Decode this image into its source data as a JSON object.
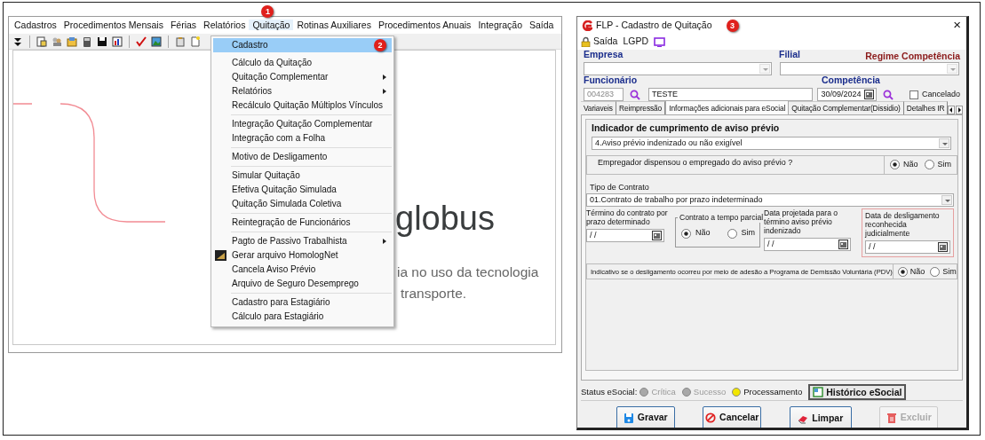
{
  "main_window": {
    "menu": [
      {
        "label": "Cadastros",
        "selected": false
      },
      {
        "label": "Procedimentos Mensais",
        "selected": false
      },
      {
        "label": "Férias",
        "selected": false
      },
      {
        "label": "Relatórios",
        "selected": false
      },
      {
        "label": "Quitação",
        "selected": true,
        "badge": "1"
      },
      {
        "label": "Rotinas Auxiliares",
        "selected": false
      },
      {
        "label": "Procedimentos Anuais",
        "selected": false
      },
      {
        "label": "Integração",
        "selected": false
      },
      {
        "label": "Saída",
        "selected": false
      }
    ],
    "background": {
      "brand": "globus",
      "tagline": [
        "ia no uso da tecnologia",
        "transporte."
      ]
    },
    "dropdown": [
      {
        "kind": "item",
        "label": "Cadastro",
        "selected": true,
        "badge": "2"
      },
      {
        "kind": "item",
        "label": "Cálculo da Quitação",
        "selected": false
      },
      {
        "kind": "submenu",
        "label": "Quitação Complementar",
        "selected": false
      },
      {
        "kind": "submenu",
        "label": "Relatórios",
        "selected": false
      },
      {
        "kind": "item",
        "label": "Recálculo Quitação Múltiplos Vínculos",
        "selected": false
      },
      {
        "kind": "separator"
      },
      {
        "kind": "item",
        "label": "Integração Quitação Complementar",
        "selected": false
      },
      {
        "kind": "item",
        "label": "Integração com a Folha",
        "selected": false
      },
      {
        "kind": "separator"
      },
      {
        "kind": "item",
        "label": "Motivo de Desligamento",
        "selected": false
      },
      {
        "kind": "separator"
      },
      {
        "kind": "item",
        "label": "Simular Quitação",
        "selected": false
      },
      {
        "kind": "item",
        "label": "Efetiva Quitação Simulada",
        "selected": false
      },
      {
        "kind": "item",
        "label": "Quitação Simulada Coletiva",
        "selected": false
      },
      {
        "kind": "separator"
      },
      {
        "kind": "item",
        "label": "Reintegração de Funcionários",
        "selected": false
      },
      {
        "kind": "separator"
      },
      {
        "kind": "submenu",
        "label": "Pagto de Passivo Trabalhista",
        "selected": false
      },
      {
        "kind": "icon_item",
        "label": "Gerar arquivo HomologNet",
        "selected": false
      },
      {
        "kind": "item",
        "label": "Cancela Aviso Prévio",
        "selected": false
      },
      {
        "kind": "item",
        "label": "Arquivo de Seguro Desemprego",
        "selected": false
      },
      {
        "kind": "separator"
      },
      {
        "kind": "item",
        "label": "Cadastro para Estagiário",
        "selected": false
      },
      {
        "kind": "item",
        "label": "Cálculo para Estagiário",
        "selected": false
      }
    ]
  },
  "form_window": {
    "title": "FLP - Cadastro de Quitação",
    "badge": "3",
    "close": "×",
    "toolbar": [
      "Saída",
      "LGPD"
    ],
    "empresa": {
      "label": "Empresa"
    },
    "filial": {
      "label": "Filial"
    },
    "regime": "Regime Competência",
    "funcionario": {
      "label": "Funcionário",
      "code": "004283",
      "name": "TESTE"
    },
    "competencia": {
      "label": "Competência",
      "value": "30/09/2024"
    },
    "cancelado": {
      "label": "Cancelado",
      "checked": false
    },
    "tabs": [
      {
        "label": "Variaveis",
        "selected": false
      },
      {
        "label": "Reimpressão",
        "selected": false
      },
      {
        "label": "Informações adicionais para eSocial",
        "selected": true
      },
      {
        "label": "Quitação Complementar(Dissidio)",
        "selected": false
      },
      {
        "label": "Detalhes IR",
        "selected": false
      }
    ],
    "aviso": {
      "title": "Indicador de cumprimento de aviso prévio",
      "value": "4.Aviso prévio indenizado ou não exigível"
    },
    "dispensou": {
      "question": "Empregador dispensou o empregado do aviso prévio ?",
      "options": [
        {
          "label": "Não",
          "selected": true
        },
        {
          "label": "Sim",
          "selected": false
        }
      ]
    },
    "tipo_contrato": {
      "label": "Tipo de Contrato",
      "value": "01.Contrato de trabalho por prazo indeterminado"
    },
    "termino": {
      "label": "Término do contrato por prazo determinado",
      "value": "/ /"
    },
    "tempo_parcial": {
      "label": "Contrato a tempo parcial",
      "options": [
        {
          "label": "Não",
          "selected": true
        },
        {
          "label": "Sim",
          "selected": false
        }
      ]
    },
    "data_projetada": {
      "label": "Data projetada para o término aviso prévio indenizado",
      "value": "/ /"
    },
    "data_desligamento": {
      "label": "Data de desligamento reconhecida judicialmente",
      "value": "/ /"
    },
    "pdv": {
      "question": "Indicativo se o desligamento ocorreu por meio de adesão a Programa de Demissão Voluntária (PDV)",
      "options": [
        {
          "label": "Não",
          "selected": true
        },
        {
          "label": "Sim",
          "selected": false
        }
      ]
    },
    "status": {
      "label": "Status eSocial:",
      "lights": [
        {
          "label": "Crítica",
          "color": "#a8a8a8",
          "disabled": true
        },
        {
          "label": "Sucesso",
          "color": "#a8a8a8",
          "disabled": true
        },
        {
          "label": "Processamento",
          "color": "#f2e600",
          "disabled": false
        }
      ]
    },
    "historico": "Histórico eSocial",
    "buttons": [
      {
        "kind": "save",
        "label": "Gravar",
        "disabled": false
      },
      {
        "kind": "cancel",
        "label": "Cancelar",
        "disabled": false
      },
      {
        "kind": "clear",
        "label": "Limpar",
        "disabled": false
      },
      {
        "kind": "delete",
        "label": "Excluir",
        "disabled": true
      }
    ]
  }
}
